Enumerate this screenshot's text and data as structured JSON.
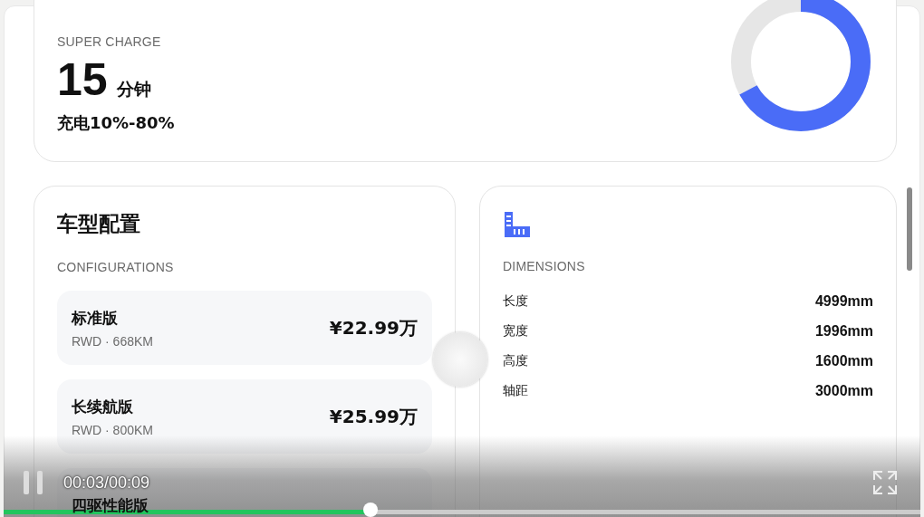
{
  "charge": {
    "label": "SUPER CHARGE",
    "value": "15",
    "unit": "分钟",
    "range": "充电10%-80%",
    "ring": {
      "level": 0.67
    }
  },
  "configurations": {
    "title": "车型配置",
    "label": "CONFIGURATIONS",
    "items": [
      {
        "name": "标准版",
        "spec": "RWD · 668KM",
        "price": "¥22.99万"
      },
      {
        "name": "长续航版",
        "spec": "RWD · 800KM",
        "price": "¥25.99万"
      },
      {
        "name": "四驱性能版"
      }
    ]
  },
  "dimensions": {
    "label": "DIMENSIONS",
    "rows": [
      {
        "name": "长度",
        "value": "4999mm"
      },
      {
        "name": "宽度",
        "value": "1996mm"
      },
      {
        "name": "高度",
        "value": "1600mm"
      },
      {
        "name": "轴距",
        "value": "3000mm"
      }
    ]
  },
  "player": {
    "playing": true,
    "time": "00:03/00:09",
    "progress": {
      "level": 0.4
    }
  }
}
